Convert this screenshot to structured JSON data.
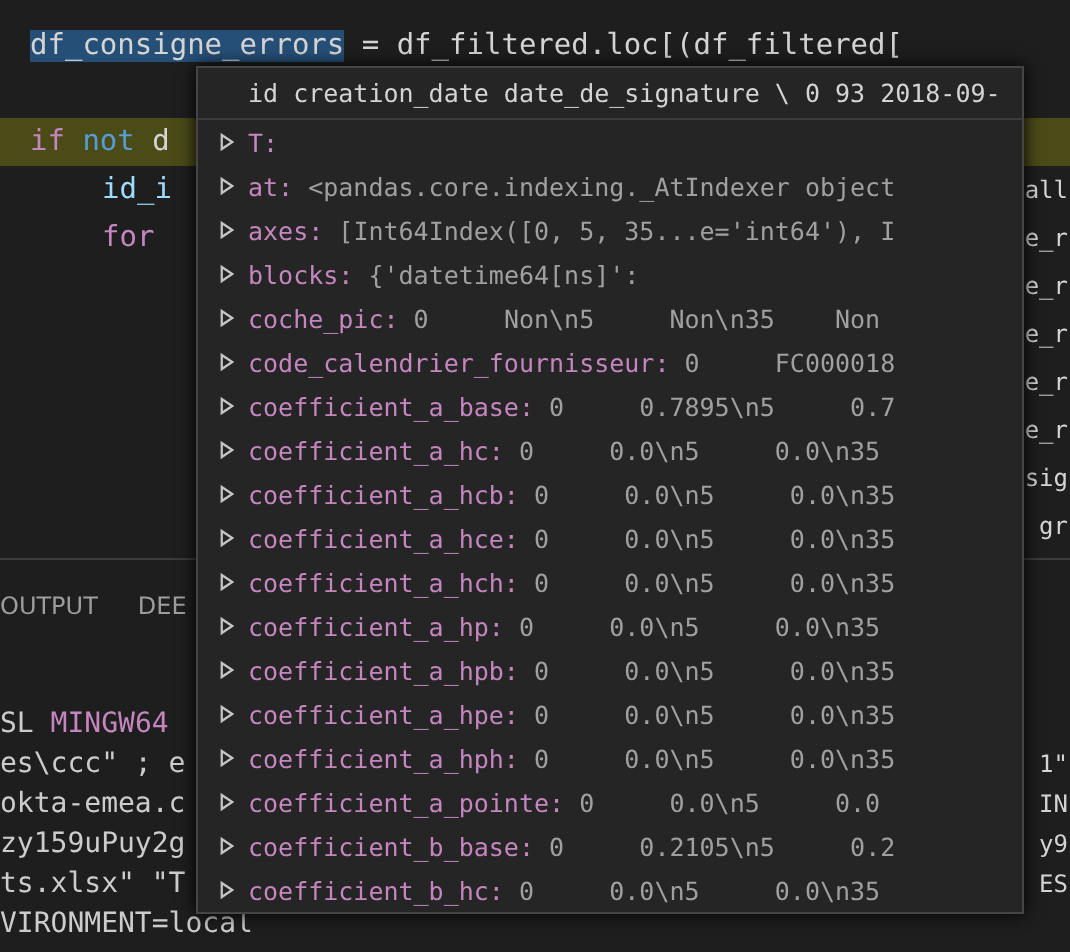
{
  "editor": {
    "lines": [
      {
        "current": false,
        "tokens": [
          {
            "text": "df_consigne_errors",
            "kind": "selection"
          },
          {
            "text": " = df_filtered.loc[(df_filtered[",
            "kind": "plain"
          }
        ]
      },
      {
        "current": false
      },
      {
        "current": true,
        "tokens": [
          {
            "text": "if",
            "kind": "keyword"
          },
          {
            "text": " not",
            "kind": "operator"
          },
          {
            "text": " d",
            "kind": "plain"
          }
        ],
        "children": [
          {
            "current": false,
            "tokens": [
              {
                "text": "id_i",
                "kind": "variable"
              }
            ],
            "right": "all"
          },
          {
            "current": false,
            "tokens": [
              {
                "text": "for",
                "kind": "keyword"
              }
            ],
            "right": "e_r"
          }
        ]
      },
      {
        "current": false,
        "right": "e_r"
      },
      {
        "current": false,
        "right": "e_r"
      },
      {
        "current": false,
        "right": "e_r"
      },
      {
        "current": false,
        "right": "e_r"
      },
      {
        "current": false,
        "right": "sig"
      },
      {
        "current": false,
        "right": "gr"
      }
    ]
  },
  "panel_tabs": [
    {
      "label": "OUTPUT",
      "selected": false
    },
    {
      "label": "DEE",
      "selected": false
    }
  ],
  "terminal": {
    "lines": [
      {
        "left": "SL ",
        "accent": "MINGW64"
      },
      {
        "left": "es\\ccc\" ; e",
        "right": "1\""
      },
      {
        "left": "okta-emea.c",
        "right": "IN"
      },
      {
        "left": "zy159uPuy2g",
        "right": "y9"
      },
      {
        "left": "ts.xlsx\" \"T",
        "right": "ES"
      },
      {
        "left": "VIRONMENT=local"
      }
    ]
  },
  "hover": {
    "header": "id creation_date date_de_signature \\ 0 93 2018-09-",
    "rows": [
      {
        "name": "T:",
        "expanded": false
      },
      {
        "name": "at:",
        "value": "<pandas.core.indexing._AtIndexer object",
        "expanded": false
      },
      {
        "name": "axes:",
        "value": "[Int64Index([0, 5, 35...e='int64'), I",
        "expanded": false
      },
      {
        "name": "blocks:",
        "value": "{'datetime64[ns]':",
        "expanded": false
      },
      {
        "name": "coche_pic:",
        "value": "0     Non\\n5     Non\\n35    Non",
        "expanded": false
      },
      {
        "name": "code_calendrier_fournisseur:",
        "value": "0     FC000018",
        "expanded": false
      },
      {
        "name": "coefficient_a_base:",
        "value": "0     0.7895\\n5     0.7",
        "expanded": false
      },
      {
        "name": "coefficient_a_hc:",
        "value": "0     0.0\\n5     0.0\\n35",
        "expanded": false
      },
      {
        "name": "coefficient_a_hcb:",
        "value": "0     0.0\\n5     0.0\\n35",
        "expanded": false
      },
      {
        "name": "coefficient_a_hce:",
        "value": "0     0.0\\n5     0.0\\n35",
        "expanded": false
      },
      {
        "name": "coefficient_a_hch:",
        "value": "0     0.0\\n5     0.0\\n35",
        "expanded": false
      },
      {
        "name": "coefficient_a_hp:",
        "value": "0     0.0\\n5     0.0\\n35",
        "expanded": false
      },
      {
        "name": "coefficient_a_hpb:",
        "value": "0     0.0\\n5     0.0\\n35",
        "expanded": false
      },
      {
        "name": "coefficient_a_hpe:",
        "value": "0     0.0\\n5     0.0\\n35",
        "expanded": false
      },
      {
        "name": "coefficient_a_hph:",
        "value": "0     0.0\\n5     0.0\\n35",
        "expanded": false
      },
      {
        "name": "coefficient_a_pointe:",
        "value": "0     0.0\\n5     0.0",
        "expanded": false
      },
      {
        "name": "coefficient_b_base:",
        "value": "0     0.2105\\n5     0.2",
        "expanded": false
      },
      {
        "name": "coefficient_b_hc:",
        "value": "0     0.0\\n5     0.0\\n35",
        "expanded": false
      }
    ]
  }
}
